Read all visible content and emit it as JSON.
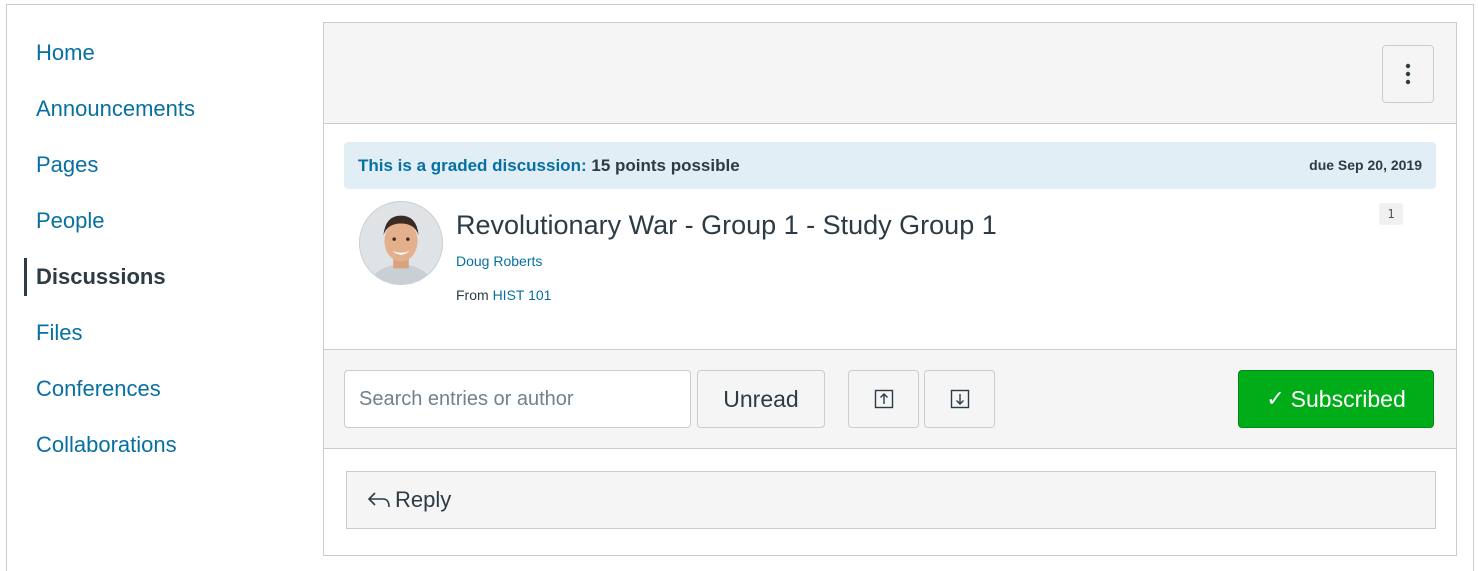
{
  "sidebar": {
    "items": [
      {
        "label": "Home"
      },
      {
        "label": "Announcements"
      },
      {
        "label": "Pages"
      },
      {
        "label": "People"
      },
      {
        "label": "Discussions",
        "active": true
      },
      {
        "label": "Files"
      },
      {
        "label": "Conferences"
      },
      {
        "label": "Collaborations"
      }
    ]
  },
  "toolbar": {
    "menu_icon": "kebab-menu-icon"
  },
  "discussion": {
    "graded_label": "This is a graded discussion:",
    "points": "15 points possible",
    "due_date": "due Sep 20, 2019",
    "title": "Revolutionary War - Group 1 - Study Group 1",
    "author": "Doug Roberts",
    "from_label": "From",
    "course": "HIST 101",
    "reply_count": "1"
  },
  "filters": {
    "search_placeholder": "Search entries or author",
    "unread_label": "Unread",
    "collapse_icon": "collapse-replies-icon",
    "expand_icon": "expand-replies-icon",
    "subscribed_label": "Subscribed",
    "subscribed_color": "#00ac18"
  },
  "reply": {
    "label": "Reply"
  },
  "colors": {
    "link": "#0770a3",
    "banner": "#e2eef6",
    "text": "#2d3b45"
  }
}
